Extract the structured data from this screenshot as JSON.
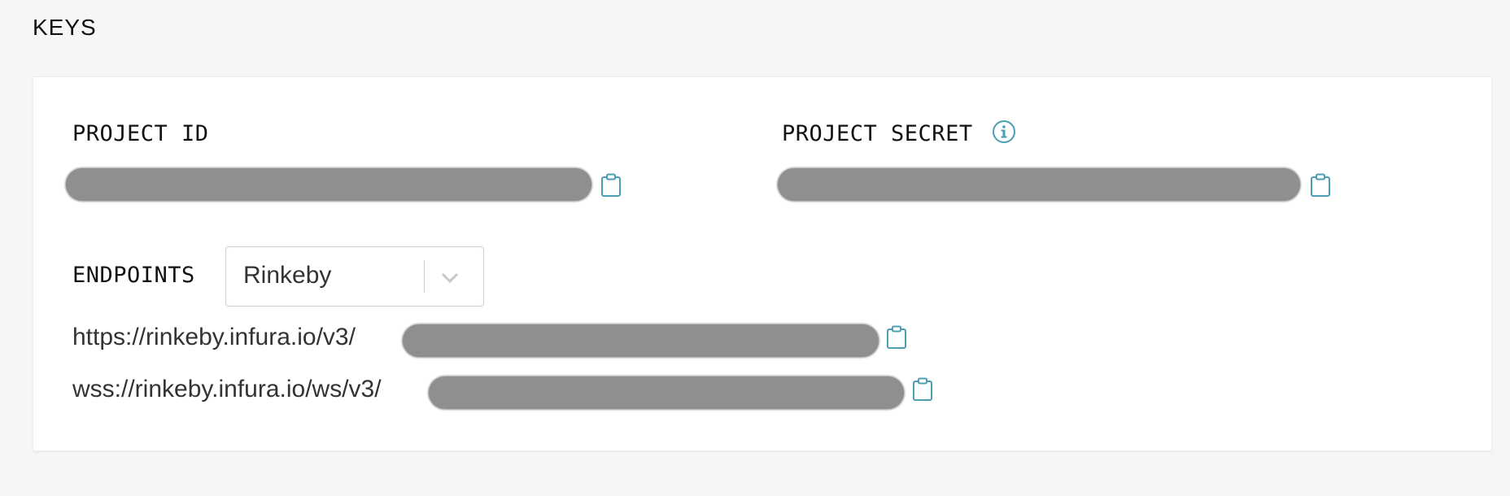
{
  "section": {
    "title": "KEYS"
  },
  "project_id": {
    "label": "PROJECT ID"
  },
  "project_secret": {
    "label": "PROJECT SECRET"
  },
  "endpoints": {
    "label": "ENDPOINTS",
    "network": "Rinkeby",
    "https_prefix": "https://rinkeby.infura.io/v3/",
    "wss_prefix": "wss://rinkeby.infura.io/ws/v3/"
  },
  "colors": {
    "accent": "#4a9fb5",
    "redaction": "#8f8f8f"
  },
  "icons": {
    "copy": "clipboard-icon",
    "info": "info-icon",
    "dropdown": "chevron-down-icon"
  }
}
